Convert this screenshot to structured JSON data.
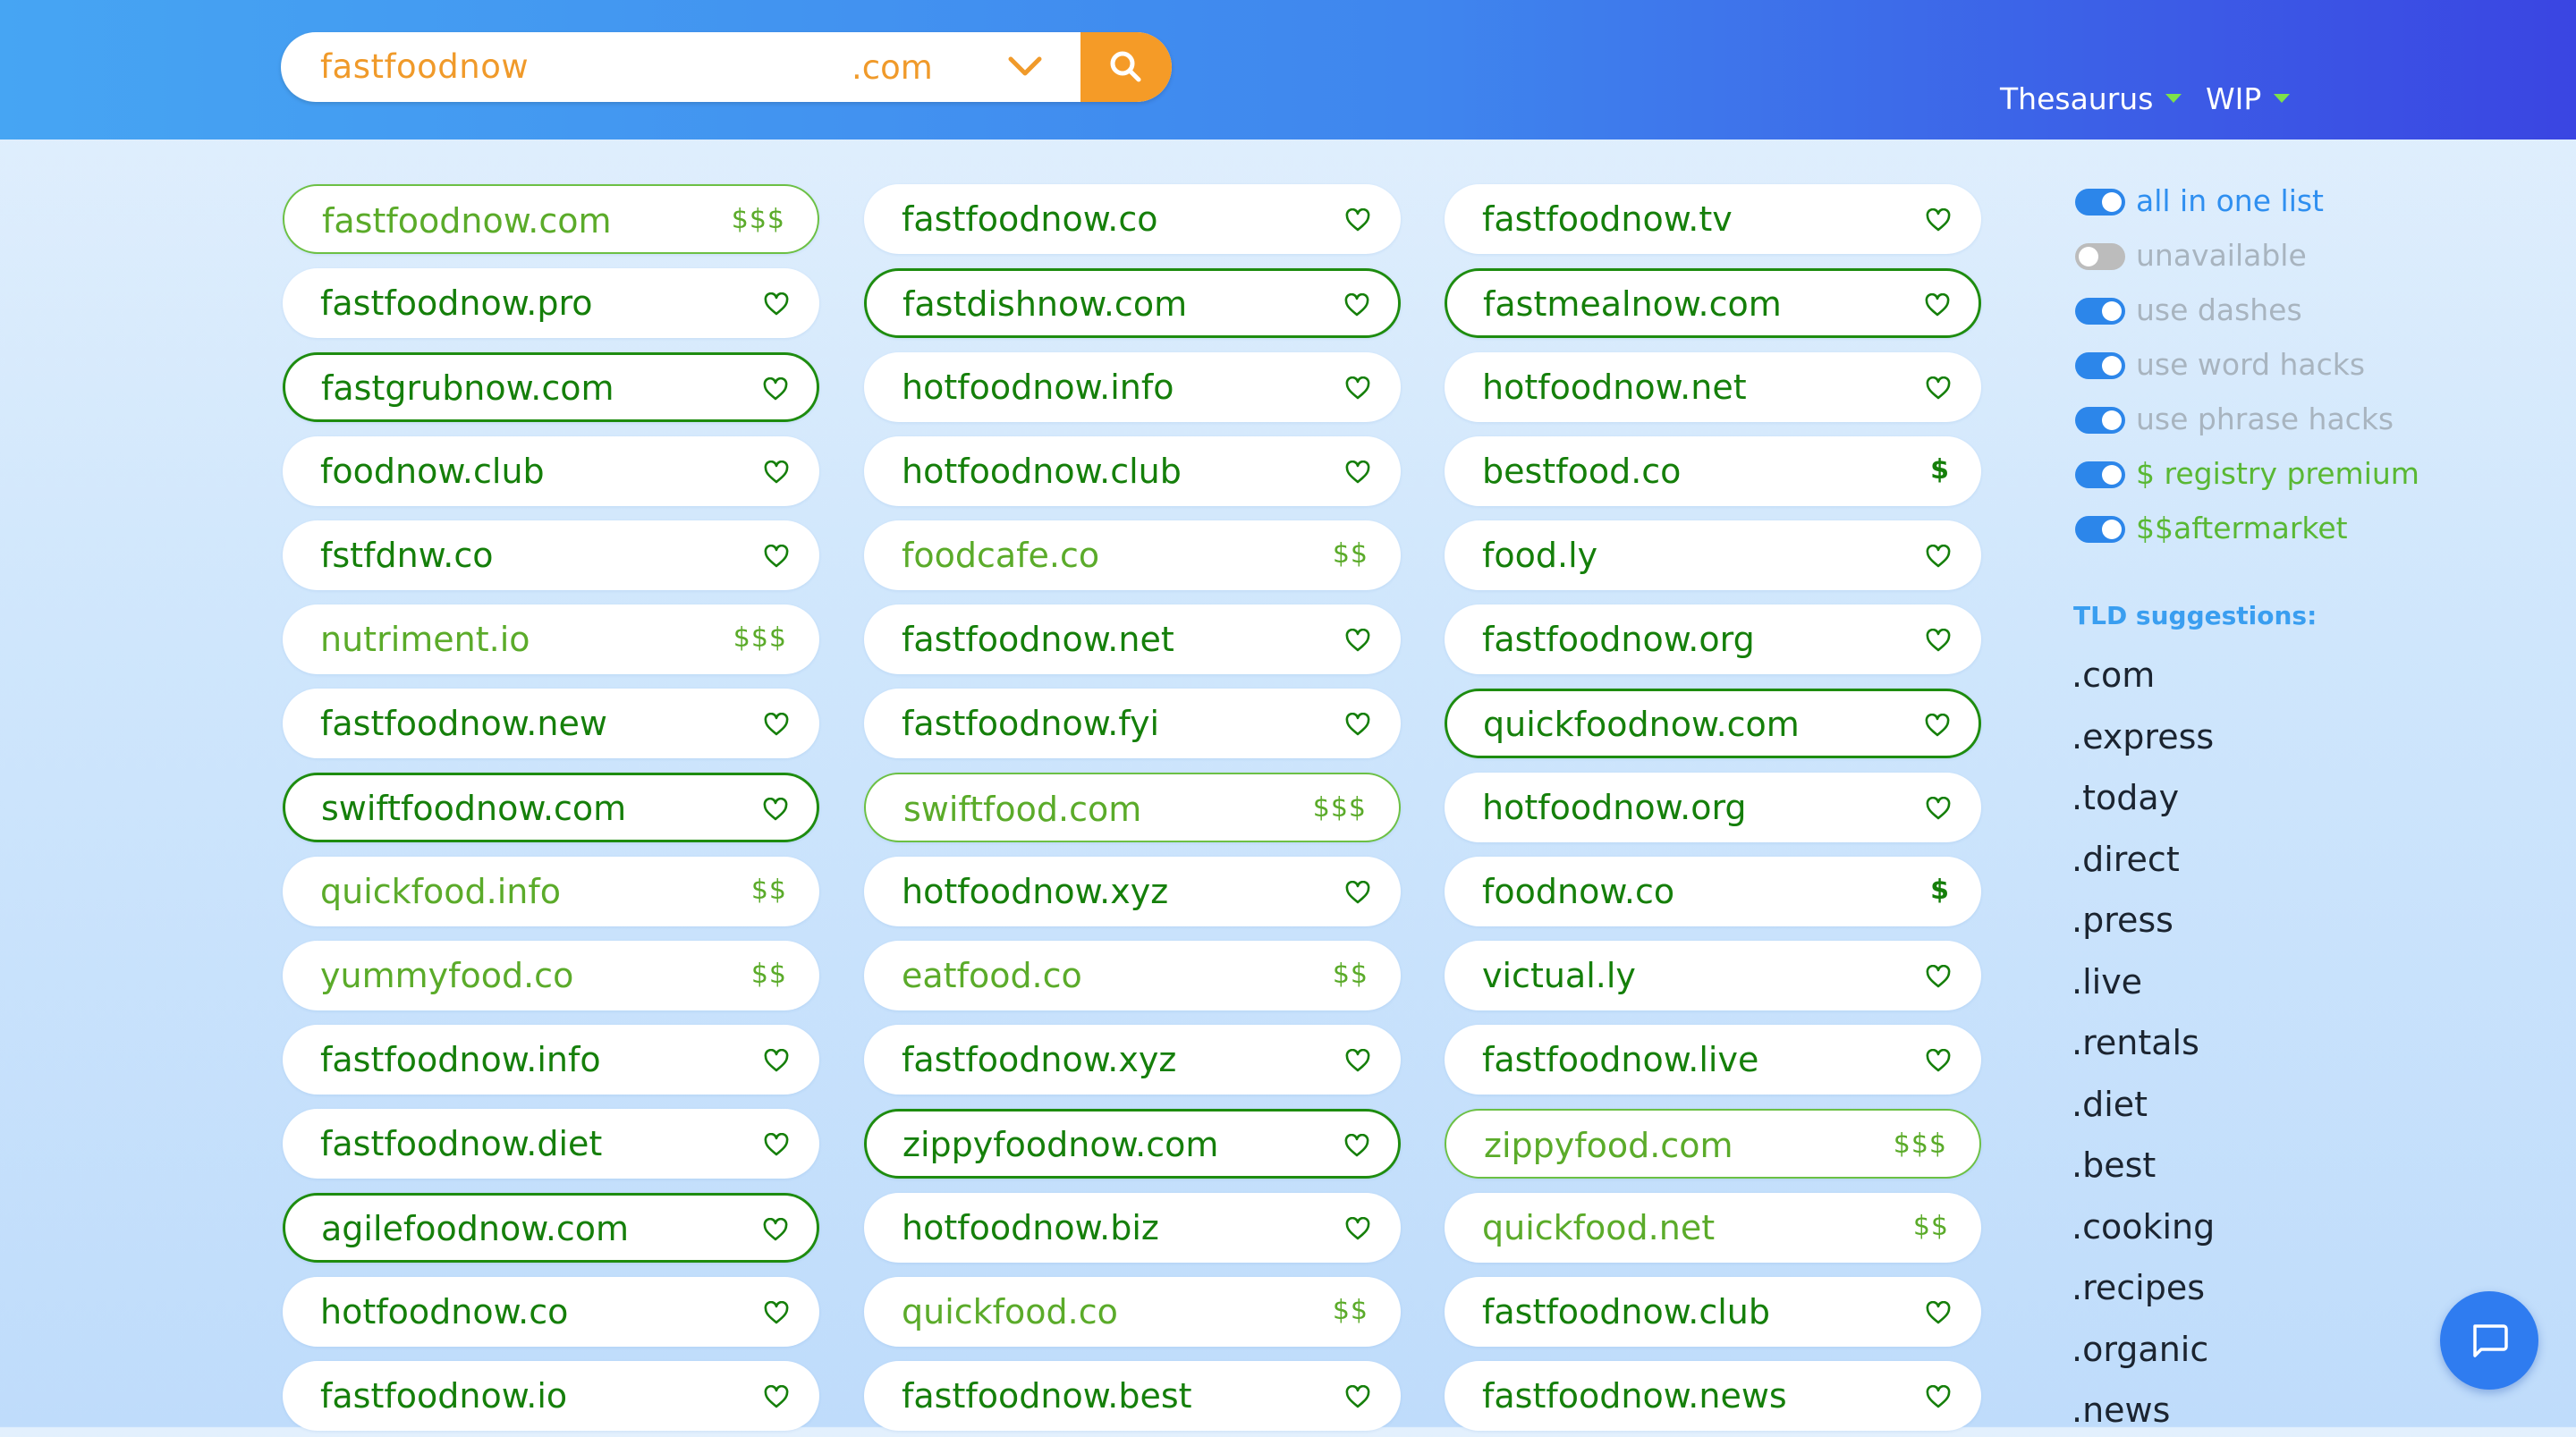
{
  "search": {
    "query": "fastfoodnow",
    "tld": ".com"
  },
  "nav": {
    "thesaurus": "Thesaurus",
    "wip": "WIP"
  },
  "columns": [
    [
      {
        "name": "fastfoodnow.com",
        "status": "premium",
        "price": "$$$"
      },
      {
        "name": "fastfoodnow.pro",
        "status": "normal"
      },
      {
        "name": "fastgrubnow.com",
        "status": "available"
      },
      {
        "name": "foodnow.club",
        "status": "normal"
      },
      {
        "name": "fstfdnw.co",
        "status": "normal"
      },
      {
        "name": "nutriment.io",
        "status": "priced",
        "price": "$$$"
      },
      {
        "name": "fastfoodnow.new",
        "status": "normal"
      },
      {
        "name": "swiftfoodnow.com",
        "status": "available"
      },
      {
        "name": "quickfood.info",
        "status": "priced",
        "price": "$$"
      },
      {
        "name": "yummyfood.co",
        "status": "priced",
        "price": "$$"
      },
      {
        "name": "fastfoodnow.info",
        "status": "normal"
      },
      {
        "name": "fastfoodnow.diet",
        "status": "normal"
      },
      {
        "name": "agilefoodnow.com",
        "status": "available"
      },
      {
        "name": "hotfoodnow.co",
        "status": "normal"
      },
      {
        "name": "fastfoodnow.io",
        "status": "normal"
      }
    ],
    [
      {
        "name": "fastfoodnow.co",
        "status": "normal"
      },
      {
        "name": "fastdishnow.com",
        "status": "available"
      },
      {
        "name": "hotfoodnow.info",
        "status": "normal"
      },
      {
        "name": "hotfoodnow.club",
        "status": "normal"
      },
      {
        "name": "foodcafe.co",
        "status": "priced",
        "price": "$$"
      },
      {
        "name": "fastfoodnow.net",
        "status": "normal"
      },
      {
        "name": "fastfoodnow.fyi",
        "status": "normal"
      },
      {
        "name": "swiftfood.com",
        "status": "premium",
        "price": "$$$"
      },
      {
        "name": "hotfoodnow.xyz",
        "status": "normal"
      },
      {
        "name": "eatfood.co",
        "status": "priced",
        "price": "$$"
      },
      {
        "name": "fastfoodnow.xyz",
        "status": "normal"
      },
      {
        "name": "zippyfoodnow.com",
        "status": "available"
      },
      {
        "name": "hotfoodnow.biz",
        "status": "normal"
      },
      {
        "name": "quickfood.co",
        "status": "priced",
        "price": "$$"
      },
      {
        "name": "fastfoodnow.best",
        "status": "normal"
      }
    ],
    [
      {
        "name": "fastfoodnow.tv",
        "status": "normal"
      },
      {
        "name": "fastmealnow.com",
        "status": "available"
      },
      {
        "name": "hotfoodnow.net",
        "status": "normal"
      },
      {
        "name": "bestfood.co",
        "status": "registry",
        "price": "$"
      },
      {
        "name": "food.ly",
        "status": "normal"
      },
      {
        "name": "fastfoodnow.org",
        "status": "normal"
      },
      {
        "name": "quickfoodnow.com",
        "status": "available"
      },
      {
        "name": "hotfoodnow.org",
        "status": "normal"
      },
      {
        "name": "foodnow.co",
        "status": "registry",
        "price": "$"
      },
      {
        "name": "victual.ly",
        "status": "normal"
      },
      {
        "name": "fastfoodnow.live",
        "status": "normal"
      },
      {
        "name": "zippyfood.com",
        "status": "premium",
        "price": "$$$"
      },
      {
        "name": "quickfood.net",
        "status": "priced",
        "price": "$$"
      },
      {
        "name": "fastfoodnow.club",
        "status": "normal"
      },
      {
        "name": "fastfoodnow.news",
        "status": "normal"
      }
    ]
  ],
  "options": [
    {
      "label": "all in one list",
      "on": true
    },
    {
      "label": "unavailable",
      "on": false
    },
    {
      "label": "use dashes",
      "on": true
    },
    {
      "label": "use word hacks",
      "on": true
    },
    {
      "label": "use phrase hacks",
      "on": true
    },
    {
      "label": "$ registry premium",
      "on": true
    },
    {
      "label": "$$aftermarket",
      "on": true
    }
  ],
  "tld_suggestions": {
    "heading": "TLD suggestions:",
    "items": [
      ".com",
      ".express",
      ".today",
      ".direct",
      ".press",
      ".live",
      ".rentals",
      ".diet",
      ".best",
      ".cooking",
      ".recipes",
      ".organic",
      ".news"
    ]
  },
  "colors": {
    "header_start": "#46a5f3",
    "header_end": "#3a45e2",
    "accent_orange": "#f59b27",
    "domain_green": "#157f0a",
    "priced_green": "#5bab2a",
    "toggle_blue": "#2c86ea"
  }
}
